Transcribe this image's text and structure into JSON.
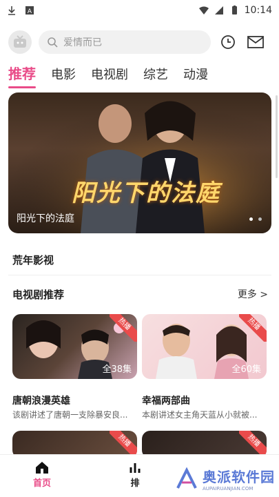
{
  "status_bar": {
    "time": "10:14",
    "icons": [
      "download-icon",
      "a-badge-icon",
      "wifi-icon",
      "signal-icon",
      "battery-icon"
    ]
  },
  "header": {
    "search_placeholder": "爱情而已",
    "icons": [
      "tv-logo-icon",
      "search-icon",
      "history-clock-icon",
      "mail-icon"
    ]
  },
  "tabs": [
    {
      "label": "推荐",
      "active": true
    },
    {
      "label": "电影",
      "active": false
    },
    {
      "label": "电视剧",
      "active": false
    },
    {
      "label": "综艺",
      "active": false
    },
    {
      "label": "动漫",
      "active": false
    }
  ],
  "banner": {
    "title": "阳光下的法庭",
    "art_title": "阳光下的法庭",
    "dots": 2,
    "active_dot": 0
  },
  "sections": {
    "first": "荒年影视",
    "second": "电视剧推荐",
    "more": "更多 >"
  },
  "cards": [
    {
      "title": "唐朝浪漫英雄",
      "desc": "该剧讲述了唐朝一支除暴安良...",
      "badge": "热播",
      "episodes": "全38集"
    },
    {
      "title": "幸福两部曲",
      "desc": "本剧讲述女主角天蓝从小就被...",
      "badge": "热播",
      "episodes": "全60集"
    },
    {
      "title": "",
      "desc": "",
      "badge": "热播",
      "episodes": ""
    },
    {
      "title": "",
      "desc": "",
      "badge": "热播",
      "episodes": ""
    }
  ],
  "bottom_nav": [
    {
      "label": "首页",
      "icon": "home-icon",
      "active": true
    },
    {
      "label": "排",
      "icon": "ranking-icon",
      "active": false
    }
  ],
  "watermark": {
    "brand": "奥派软件园",
    "url": "AUPAIRUANJIAN.COM"
  },
  "colors": {
    "accent": "#e94b88",
    "badge": "#e94b4b",
    "watermark": "#5b7ad6"
  }
}
